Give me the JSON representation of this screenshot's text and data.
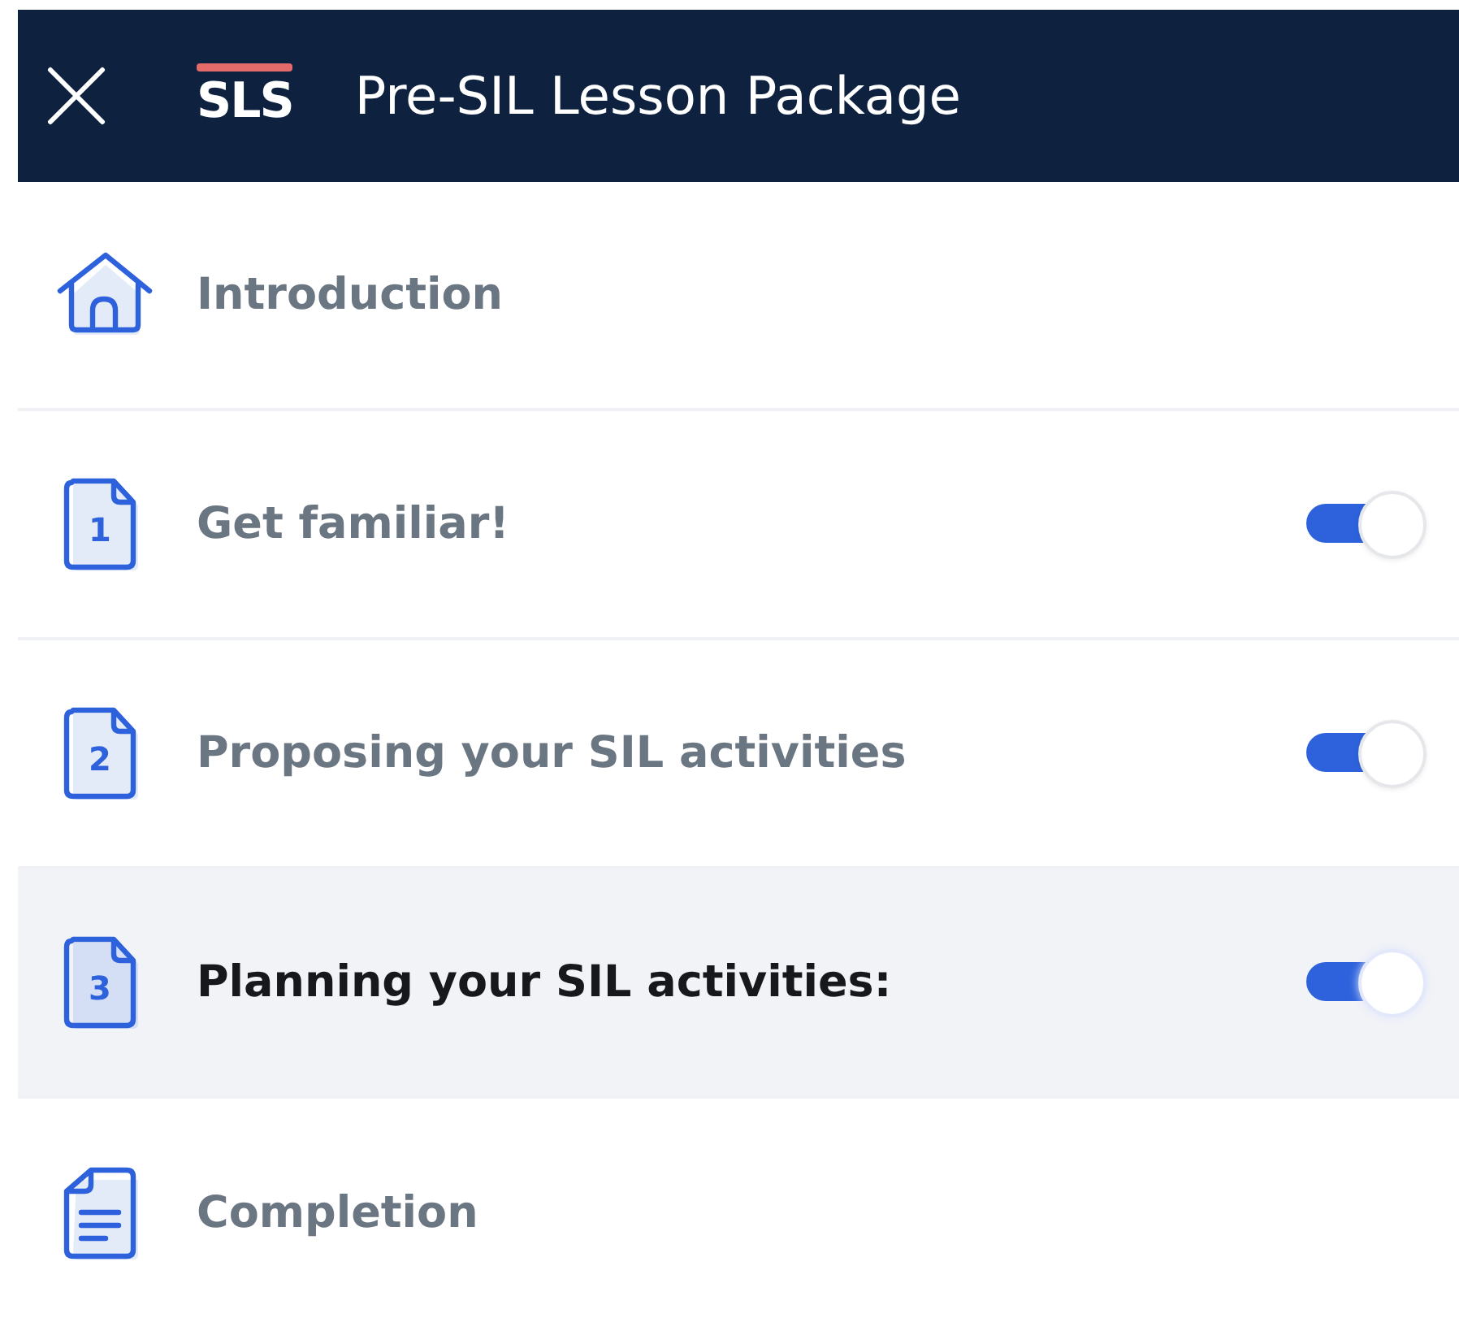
{
  "header": {
    "logo": "SLS",
    "title": "Pre-SIL Lesson Package"
  },
  "items": [
    {
      "kind": "home",
      "label": "Introduction",
      "selected": false
    },
    {
      "kind": "numbered",
      "icon_label": "1",
      "label": "Get familiar!",
      "selected": false,
      "on": true
    },
    {
      "kind": "numbered",
      "icon_label": "2",
      "label": "Proposing your SIL activities",
      "selected": false,
      "on": true
    },
    {
      "kind": "numbered",
      "icon_label": "3",
      "label": "Planning your SIL activities:",
      "selected": true,
      "on": true
    },
    {
      "kind": "list",
      "label": "Completion",
      "selected": false
    }
  ]
}
